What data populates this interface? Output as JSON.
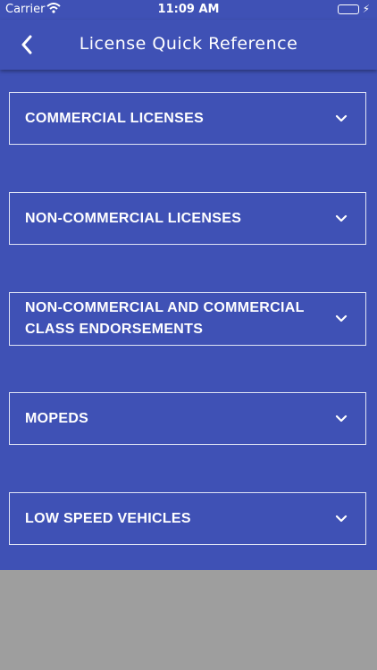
{
  "status_bar": {
    "carrier": "Carrier",
    "time": "11:09 AM"
  },
  "nav": {
    "title": "License Quick Reference"
  },
  "sections": [
    {
      "label": "COMMERCIAL LICENSES"
    },
    {
      "label": "NON-COMMERCIAL LICENSES"
    },
    {
      "label": "NON-COMMERCIAL AND COMMERCIAL CLASS ENDORSEMENTS"
    },
    {
      "label": "MOPEDS"
    },
    {
      "label": "LOW SPEED VEHICLES"
    }
  ]
}
